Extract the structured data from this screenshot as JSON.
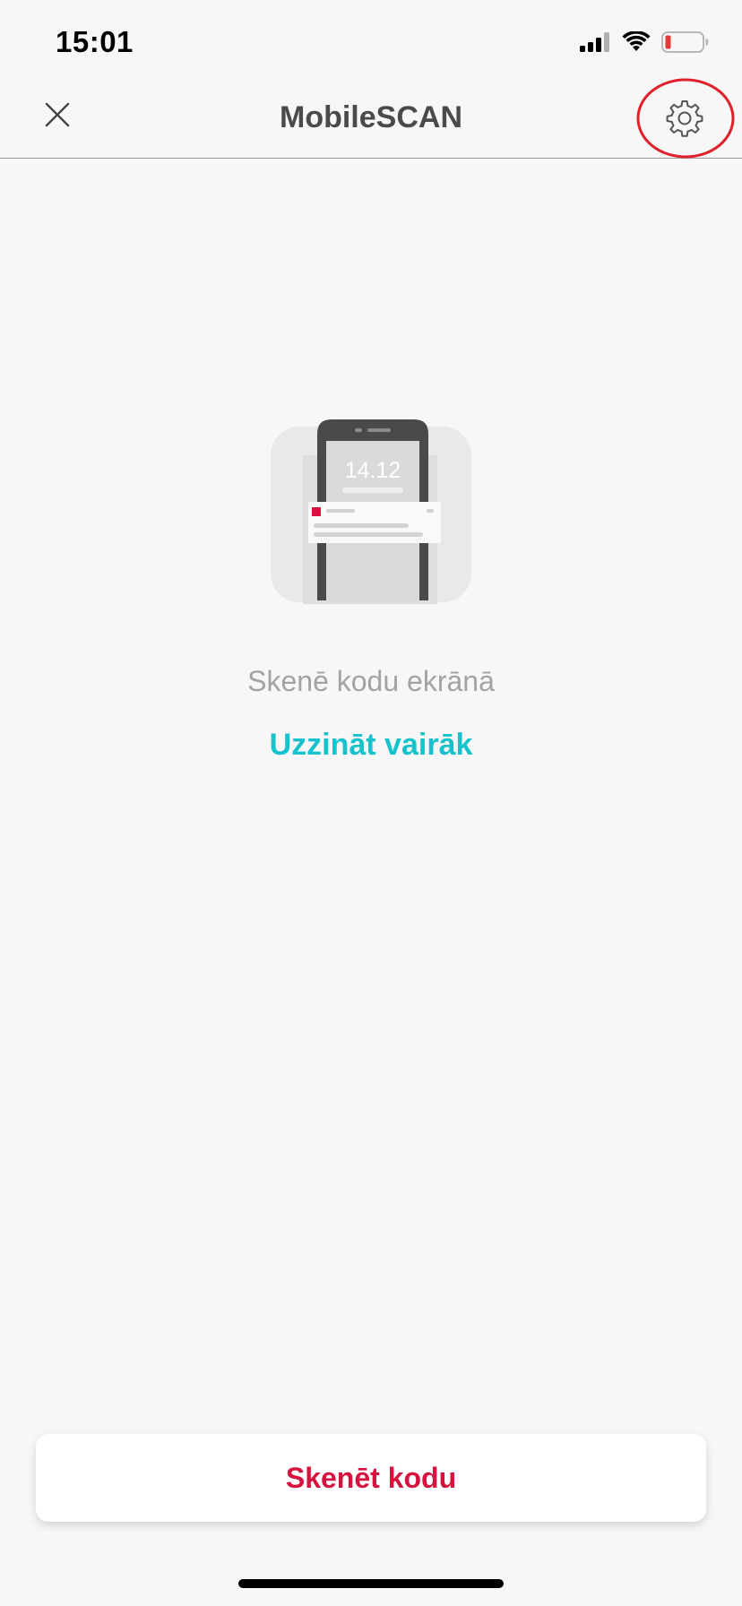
{
  "status_bar": {
    "time": "15:01"
  },
  "nav": {
    "title": "MobileSCAN"
  },
  "illustration": {
    "phone_time": "14.12"
  },
  "hint": {
    "text": "Skenē kodu ekrānā"
  },
  "learn_more": {
    "label": "Uzzināt vairāk"
  },
  "scan_button": {
    "label": "Skenēt kodu"
  },
  "icons": {
    "close": "close-icon",
    "settings": "gear-icon",
    "signal": "cellular-signal-icon",
    "wifi": "wifi-icon",
    "battery": "battery-low-icon"
  },
  "colors": {
    "accent_teal": "#16c3cc",
    "brand_red": "#d6123f",
    "highlight_red": "#e0202a",
    "background": "#f7f7f7",
    "battery_low": "#e5383b"
  }
}
